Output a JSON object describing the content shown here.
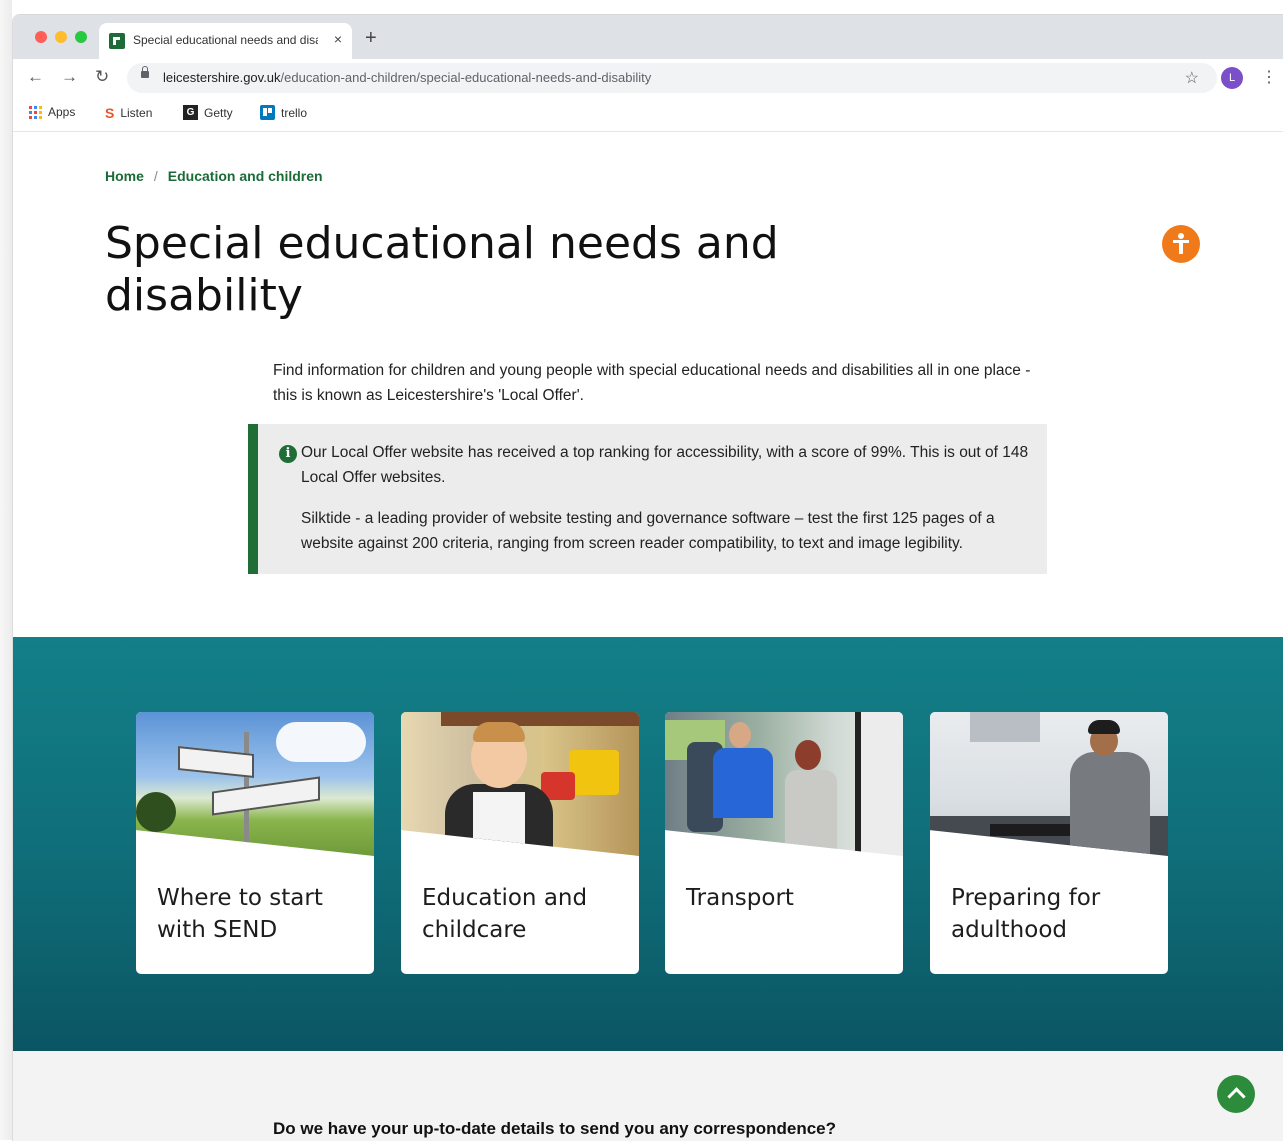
{
  "browser": {
    "tab_title": "Special educational needs and disability",
    "tab_close": "×",
    "new_tab": "+",
    "nav": {
      "back": "←",
      "forward": "→",
      "reload": "↻"
    },
    "url_host": "leicestershire.gov.uk",
    "url_path": "/education-and-children/special-educational-needs-and-disability",
    "star": "☆",
    "profile_initial": "L",
    "menu": "⋮",
    "bookmarks": [
      {
        "label": "Apps"
      },
      {
        "label": "Listen",
        "icon_text": "S"
      },
      {
        "label": "Getty",
        "icon_text": "G"
      },
      {
        "label": "trello"
      }
    ]
  },
  "breadcrumb": {
    "home": "Home",
    "separator": "/",
    "current": "Education and children"
  },
  "page": {
    "title": "Special educational needs and disability",
    "intro": "Find information for children and young people with special educational needs and disabilities all in one place - this is known as Leicestershire's 'Local Offer'.",
    "notice": {
      "icon": "i",
      "p1": "Our Local Offer website has received a top ranking for accessibility, with a score of 99%. This is out of 148 Local Offer websites.",
      "p2": "Silktide - a leading provider of website testing and governance software – test the first 125 pages of a website against 200 criteria, ranging from screen reader compatibility, to text and image legibility."
    }
  },
  "cards": [
    {
      "title": "Where to start with SEND",
      "image": "signpost"
    },
    {
      "title": "Education and childcare",
      "image": "child-in-classroom"
    },
    {
      "title": "Transport",
      "image": "people-in-minibus"
    },
    {
      "title": "Preparing for adulthood",
      "image": "young-man-cooking"
    }
  ],
  "footer": {
    "question": "Do we have your up-to-date details to send you any correspondence?"
  },
  "colors": {
    "brand_green": "#1a6b36",
    "teal": "#0f6d78",
    "accessibility_orange": "#f07a1a"
  }
}
